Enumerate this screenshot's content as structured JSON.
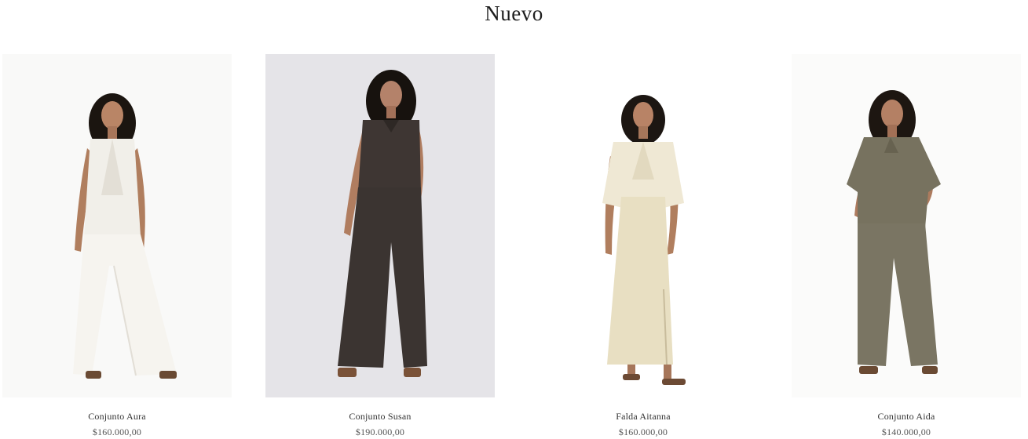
{
  "section": {
    "title": "Nuevo"
  },
  "products": [
    {
      "name": "Conjunto Aura",
      "price": "$160.000,00",
      "image": "model-white-vest-wide-pants"
    },
    {
      "name": "Conjunto Susan",
      "price": "$190.000,00",
      "image": "model-charcoal-sleeveless-jumpsuit"
    },
    {
      "name": "Falda Aitanna",
      "price": "$160.000,00",
      "image": "model-cream-satin-blouse-skirt"
    },
    {
      "name": "Conjunto Aida",
      "price": "$140.000,00",
      "image": "model-olive-shirt-trousers"
    }
  ],
  "colors": {
    "background": "#ffffff",
    "text": "#222222",
    "price": "#555555"
  }
}
